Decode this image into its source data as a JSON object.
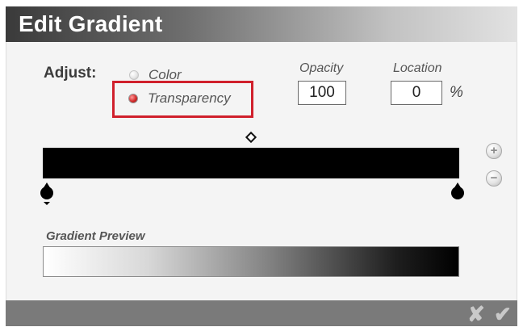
{
  "dialog": {
    "title": "Edit Gradient"
  },
  "adjust": {
    "label": "Adjust:",
    "options": [
      {
        "label": "Color",
        "selected": false
      },
      {
        "label": "Transparency",
        "selected": true
      }
    ]
  },
  "opacity": {
    "label": "Opacity",
    "value": "100"
  },
  "location": {
    "label": "Location",
    "value": "0",
    "unit": "%"
  },
  "gradient": {
    "stops": [
      {
        "location_percent": 0,
        "color": "#000000",
        "selected": true
      },
      {
        "location_percent": 100,
        "color": "#000000",
        "selected": false
      }
    ],
    "midpoint_percent": 50,
    "add_symbol": "+",
    "remove_symbol": "−"
  },
  "preview": {
    "label": "Gradient Preview"
  },
  "footer": {
    "cancel_symbol": "✘",
    "ok_symbol": "✔"
  },
  "colors": {
    "highlight": "#d0202c",
    "header_dark": "#3a3a3a",
    "footer": "#7a7a7a"
  }
}
